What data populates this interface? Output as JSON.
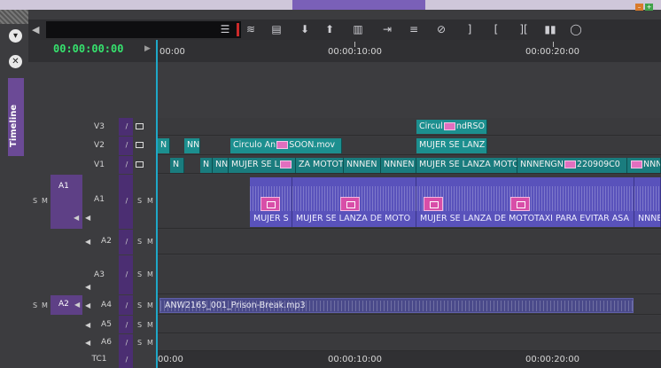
{
  "panel": {
    "side_tab_label": "Timeline"
  },
  "timecode": {
    "current": "00:00:00:00"
  },
  "ruler": {
    "labels": [
      "00:00",
      "00:00:10:00",
      "00:00:20:00"
    ]
  },
  "tracks": {
    "v3": {
      "name": "V3"
    },
    "v2": {
      "name": "V2"
    },
    "v1": {
      "name": "V1"
    },
    "a1": {
      "name": "A1",
      "source": "A1"
    },
    "a2": {
      "name": "A2"
    },
    "a3": {
      "name": "A3"
    },
    "a4": {
      "name": "A4",
      "source": "A2"
    },
    "a5": {
      "name": "A5"
    },
    "a6": {
      "name": "A6"
    },
    "tc1": {
      "name": "TC1"
    }
  },
  "solo_label": "S",
  "mute_label": "M",
  "clips": {
    "v3": [
      "Circul",
      "ndRSO"
    ],
    "v2": [
      "N",
      "NN",
      "Circulo An",
      "SOON.mov",
      "MUJER SE LANZ"
    ],
    "v1": [
      "N",
      "N",
      "NN",
      "MUJER SE L",
      "ZA MOTOT.",
      "NNNEN",
      "NNNEN",
      "MUJER SE LANZA MOTO",
      "NNNENGN",
      "220909C0",
      "NNNE"
    ],
    "a1": [
      "MUJER S",
      "MUJER SE LANZA DE MOTO",
      "MUJER SE LANZA DE MOTOTAXI PARA EVITAR ASA",
      "NNNE"
    ],
    "a4": "ANW2165_001_Prison-Break.mp3"
  }
}
